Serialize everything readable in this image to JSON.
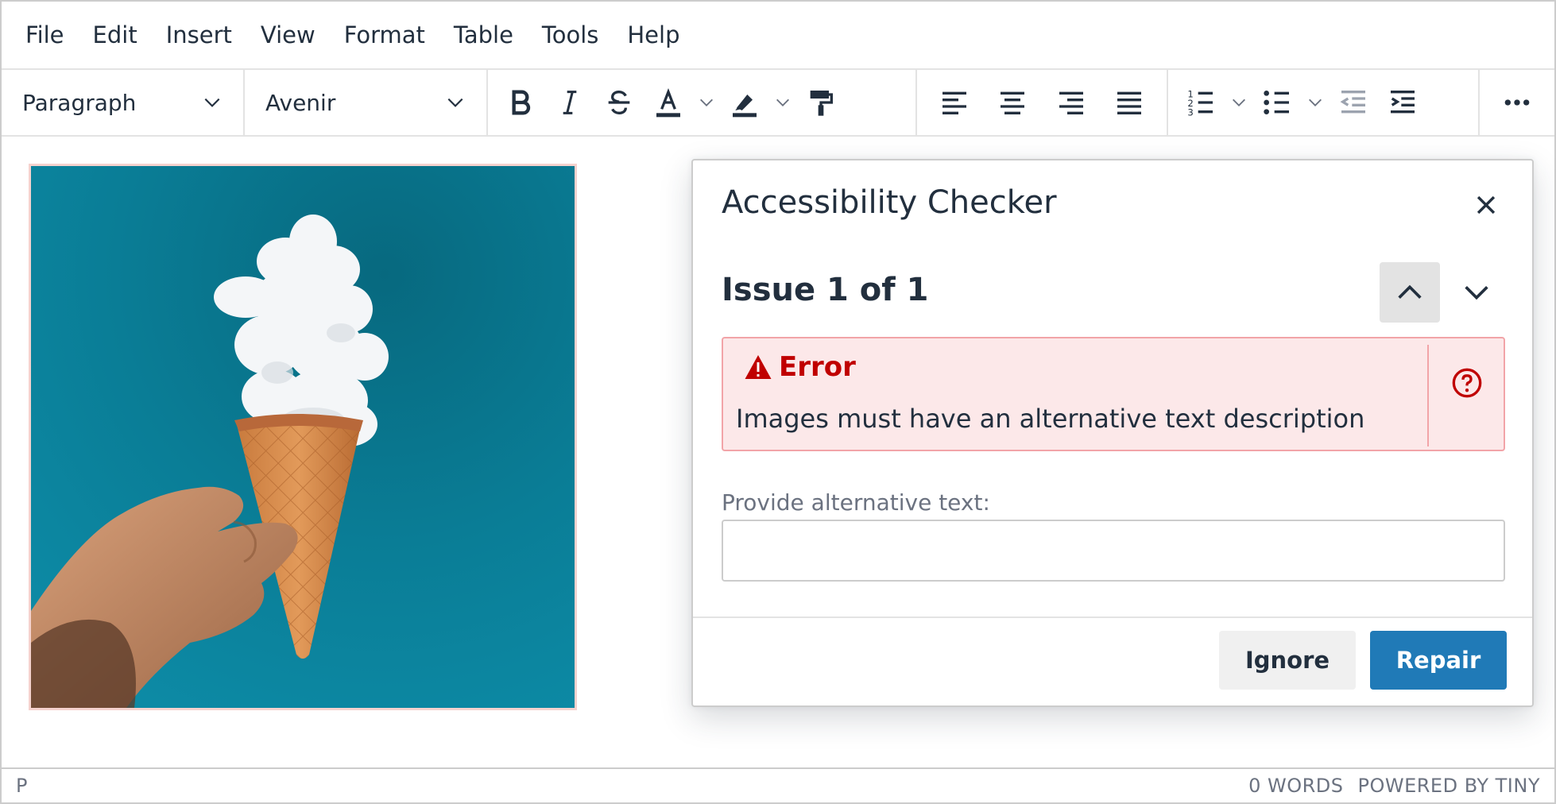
{
  "menubar": {
    "items": [
      "File",
      "Edit",
      "Insert",
      "View",
      "Format",
      "Table",
      "Tools",
      "Help"
    ]
  },
  "toolbar": {
    "block_format": "Paragraph",
    "font_family": "Avenir",
    "icons": [
      "bold-icon",
      "italic-icon",
      "strikethrough-icon",
      "text-color-icon",
      "highlight-icon",
      "format-painter-icon",
      "align-left-icon",
      "align-center-icon",
      "align-right-icon",
      "align-justify-icon",
      "numbered-list-icon",
      "bullet-list-icon",
      "outdent-icon",
      "indent-icon",
      "more-icon"
    ]
  },
  "dialog": {
    "title": "Accessibility Checker",
    "issue_title": "Issue 1 of 1",
    "error_label": "Error",
    "error_message": "Images must have an alternative text description",
    "alt_label": "Provide alternative text:",
    "alt_value": "",
    "ignore_label": "Ignore",
    "repair_label": "Repair"
  },
  "statusbar": {
    "path": "P",
    "word_count": "0 WORDS",
    "branding": "POWERED BY TINY"
  },
  "colors": {
    "text": "#222f3e",
    "error": "#c00000",
    "error_bg": "#fce8e9",
    "primary": "#207ab7",
    "image_bg": "#0a7d96"
  }
}
